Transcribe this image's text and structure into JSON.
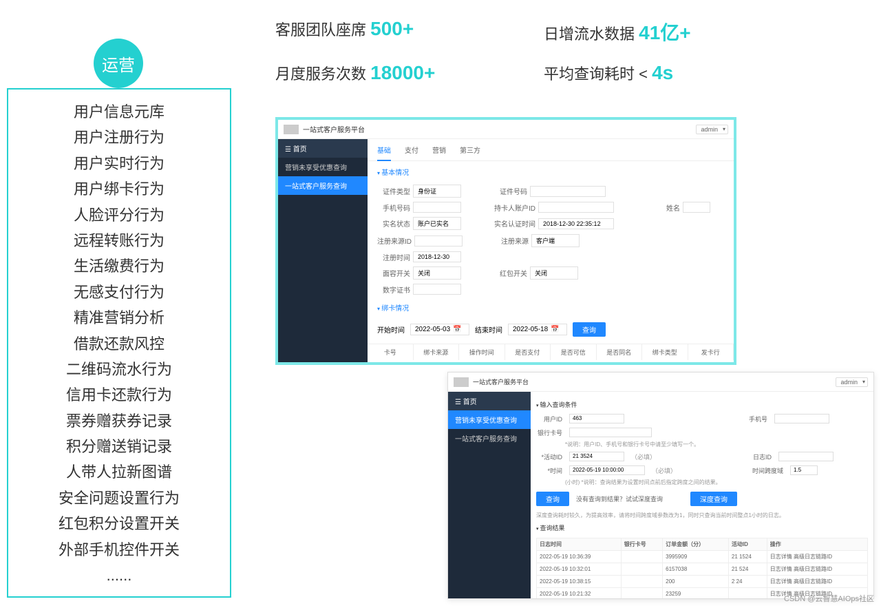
{
  "badge": "运营",
  "left_items": [
    "用户信息元库",
    "用户注册行为",
    "用户实时行为",
    "用户绑卡行为",
    "人脸评分行为",
    "远程转账行为",
    "生活缴费行为",
    "无感支付行为",
    "精准营销分析",
    "借款还款风控",
    "二维码流水行为",
    "信用卡还款行为",
    "票券赠获券记录",
    "积分赠送销记录",
    "人带人拉新图谱",
    "安全问题设置行为",
    "红包积分设置开关",
    "外部手机控件开关",
    "......"
  ],
  "stats": [
    {
      "label": "客服团队座席 ",
      "value": "500+"
    },
    {
      "label": "日增流水数据 ",
      "value": "41亿+"
    },
    {
      "label": "月度服务次数 ",
      "value": "18000+"
    },
    {
      "label": "平均查询耗时 < ",
      "value": "4s"
    }
  ],
  "shot1": {
    "title": "一站式客户服务平台",
    "user": "admin",
    "side": {
      "home": "☰  首页",
      "items": [
        "营销未享受优惠查询",
        "一站式客户服务查询"
      ],
      "active": 1
    },
    "tabs": [
      "基础",
      "支付",
      "营销",
      "第三方"
    ],
    "section_basic": "基本情况",
    "fields": {
      "doc_type": {
        "label": "证件类型",
        "value": "身份证"
      },
      "doc_no": {
        "label": "证件号码",
        "value": ""
      },
      "phone": {
        "label": "手机号码",
        "value": ""
      },
      "card_user": {
        "label": "持卡人账户ID",
        "value": ""
      },
      "name": {
        "label": "姓名",
        "value": ""
      },
      "real_status": {
        "label": "实名状态",
        "value": "账户已实名"
      },
      "real_time": {
        "label": "实名认证时间",
        "value": "2018-12-30 22:35:12"
      },
      "reg_src_id": {
        "label": "注册来源ID",
        "value": ""
      },
      "reg_src": {
        "label": "注册来源",
        "value": "客户端"
      },
      "reg_time": {
        "label": "注册时间",
        "value": "2018-12-30"
      },
      "face_switch": {
        "label": "面容开关",
        "value": "关闭"
      },
      "hb_switch": {
        "label": "红包开关",
        "value": "关闭"
      },
      "cert": {
        "label": "数字证书",
        "value": ""
      }
    },
    "section_card": "绑卡情况",
    "date": {
      "start_label": "开始时间",
      "start": "2022-05-03",
      "end_label": "结束时间",
      "end": "2022-05-18",
      "btn": "查询"
    },
    "cols": [
      "卡号",
      "绑卡来源",
      "操作时间",
      "是否支付",
      "是否可信",
      "是否同名",
      "绑卡类型",
      "发卡行"
    ]
  },
  "shot2": {
    "title": "一站式客户服务平台",
    "user": "admin",
    "side": {
      "home": "☰  首页",
      "items": [
        "营销未享受优惠查询",
        "一站式客户服务查询"
      ],
      "active": 0
    },
    "sec_query": "输入查询条件",
    "user_id": {
      "label": "用户ID",
      "value": "463"
    },
    "phone": {
      "label": "手机号",
      "value": ""
    },
    "bank": {
      "label": "银行卡号",
      "value": ""
    },
    "hint1": "*说明：用户ID、手机号和银行卡号中请至少填写一个。",
    "activity": {
      "label": "*活动ID",
      "value": "21        3524",
      "note": "（必填）"
    },
    "log_id": {
      "label": "日志ID",
      "value": ""
    },
    "time": {
      "label": "*时间",
      "value": "2022-05-19 10:00:00",
      "note": "（必填）"
    },
    "span": {
      "label": "时间跨度域",
      "value": "1.5"
    },
    "hint2": "(小时)  *说明：查询结果为设置时间点前后指定跨度之间的结果。",
    "btn_query": "查询",
    "no_result": "没有查询到结果？试试深度查询",
    "btn_deep": "深度查询",
    "hint3": "深度查询耗时较久，为提高效率，请将时间跨度域参数改为1，同时只查询当前时间整点1小时的日志。",
    "sec_result": "查询结果",
    "cols": [
      "日志时间",
      "银行卡号",
      "订单金额（分）",
      "活动ID",
      "操作"
    ],
    "rows": [
      {
        "t": "2022-05-19 10:36:39",
        "b": "",
        "a": "3995909",
        "c": "21          1524",
        "op": "日志详情 高级日志链路ID"
      },
      {
        "t": "2022-05-19 10:32:01",
        "b": "",
        "a": "6157038",
        "c": "21           524",
        "op": "日志详情 高级日志链路ID"
      },
      {
        "t": "2022-05-19 10:38:15",
        "b": "",
        "a": "200",
        "c": "2              24",
        "op": "日志详情 高级日志链路ID"
      },
      {
        "t": "2022-05-19 10:21:32",
        "b": "",
        "a": "23259",
        "c": "",
        "op": "日志详情 高级日志链路ID"
      }
    ]
  },
  "watermark": "CSDN @云智慧AIOps社区"
}
